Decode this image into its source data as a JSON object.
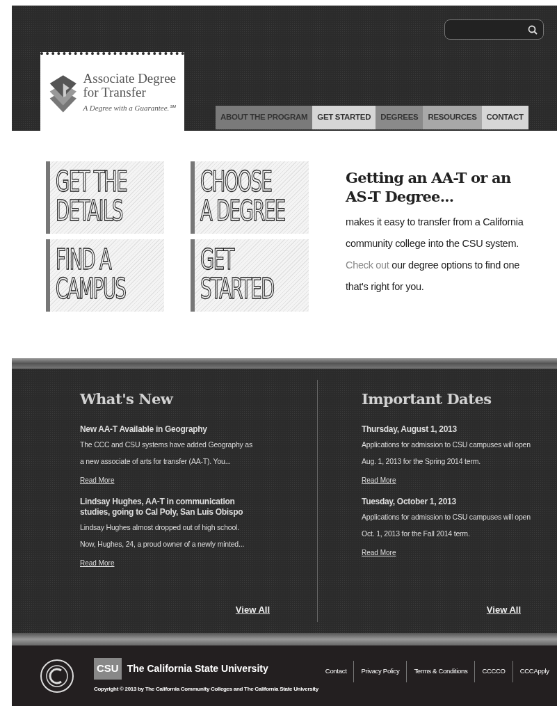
{
  "header": {
    "logo": {
      "title_lines": [
        "Associate Degree",
        "for Transfer"
      ],
      "tagline": "A Degree with a Guarantee.℠"
    },
    "nav": [
      {
        "label": "ABOUT THE PROGRAM",
        "color": "#7a7a7a"
      },
      {
        "label": "GET STARTED",
        "color": "#d6d6d6"
      },
      {
        "label": "DEGREES",
        "color": "#8a8a8a"
      },
      {
        "label": "RESOURCES",
        "color": "#a8a8a8"
      },
      {
        "label": "CONTACT",
        "color": "#d6d6d6"
      }
    ]
  },
  "tiles": [
    {
      "lines": [
        "GET THE",
        "DETAILS"
      ]
    },
    {
      "lines": [
        "CHOOSE",
        "A DEGREE"
      ]
    },
    {
      "lines": [
        "FIND A",
        "CAMPUS"
      ]
    },
    {
      "lines": [
        "GET",
        "STARTED"
      ]
    }
  ],
  "intro": {
    "heading": "Getting an AA-T or an AS-T Degree...",
    "link": "Check out",
    "before": "makes it easy to transfer from a California community college into the CSU system.",
    "after": "our degree options to find one that's right for you."
  },
  "whats_new": {
    "title": "What's New",
    "items": [
      {
        "headline": "New AA-T Available in Geography",
        "body": "The CCC and CSU systems have added Geography as a new associate of arts for transfer (AA-T). You...",
        "link": "Read More"
      },
      {
        "headline": "Lindsay Hughes, AA-T in communication studies, going to Cal Poly, San Luis Obispo",
        "body": "Lindsay Hughes almost dropped out of high school. Now, Hughes, 24, a proud owner of a newly minted...",
        "link": "Read More"
      }
    ],
    "view_all": "View All"
  },
  "important_dates": {
    "title": "Important Dates",
    "items": [
      {
        "headline": "Thursday, August 1, 2013",
        "body": "Applications for admission to CSU campuses will open Aug. 1, 2013 for the Spring 2014 term.",
        "link": "Read More"
      },
      {
        "headline": "Tuesday, October 1, 2013",
        "body": "Applications for admission to CSU campuses will open Oct. 1, 2013 for the Fall 2014 term.",
        "link": "Read More"
      }
    ],
    "view_all": "View All"
  },
  "footer": {
    "csu_mark": "CSU",
    "csu_name": "The California State University",
    "copyright": "Copyright © 2013 by The California Community Colleges and The California State University",
    "links": [
      "Contact",
      "Privacy Policy",
      "Terms & Conditions",
      "CCCCO",
      "CCCApply"
    ]
  }
}
